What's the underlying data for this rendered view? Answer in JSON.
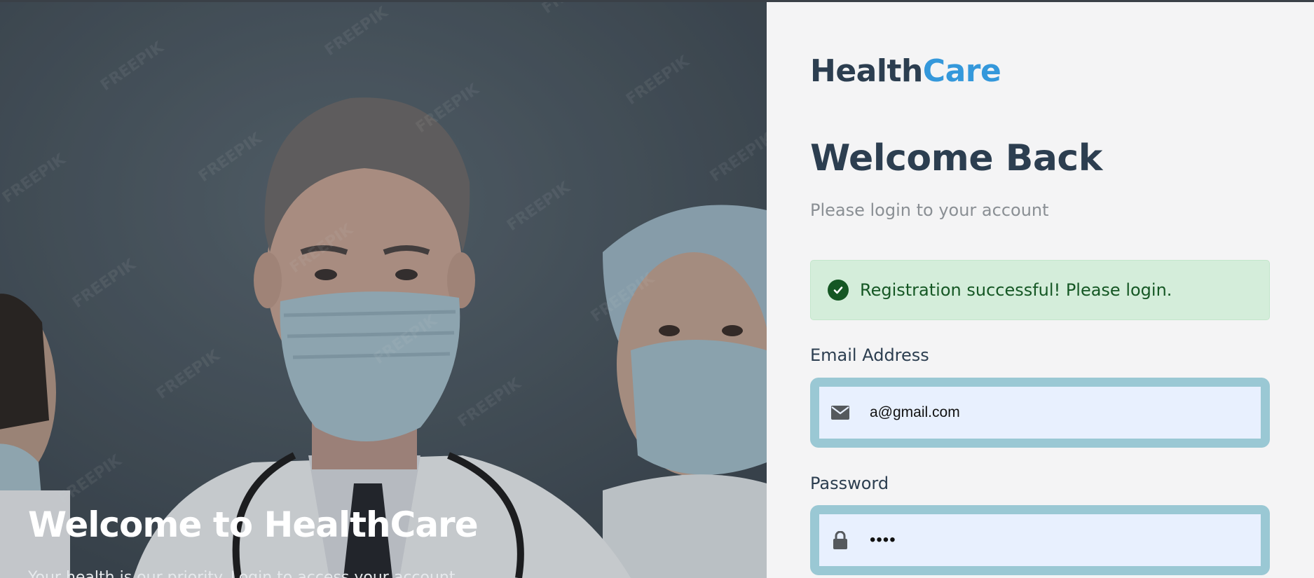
{
  "hero": {
    "title": "Welcome to HealthCare",
    "subtitle": "Your health is our priority. Login to access your account.",
    "watermark": "FREEPIK"
  },
  "brand": {
    "part1": "Health",
    "part2": "Care"
  },
  "login": {
    "heading": "Welcome Back",
    "subheading": "Please login to your account",
    "alert": {
      "message": "Registration successful! Please login.",
      "icon": "check-circle-icon"
    },
    "email": {
      "label": "Email Address",
      "value": "a@gmail.com",
      "icon": "envelope-icon"
    },
    "password": {
      "label": "Password",
      "value": "abcd",
      "icon": "lock-icon"
    }
  },
  "colors": {
    "brand_dark": "#2c3e50",
    "brand_accent": "#3498db",
    "alert_bg": "#d4edda",
    "alert_text": "#155724",
    "field_focus_ring": "#9ac8d4",
    "field_bg": "#e8f0fe"
  }
}
